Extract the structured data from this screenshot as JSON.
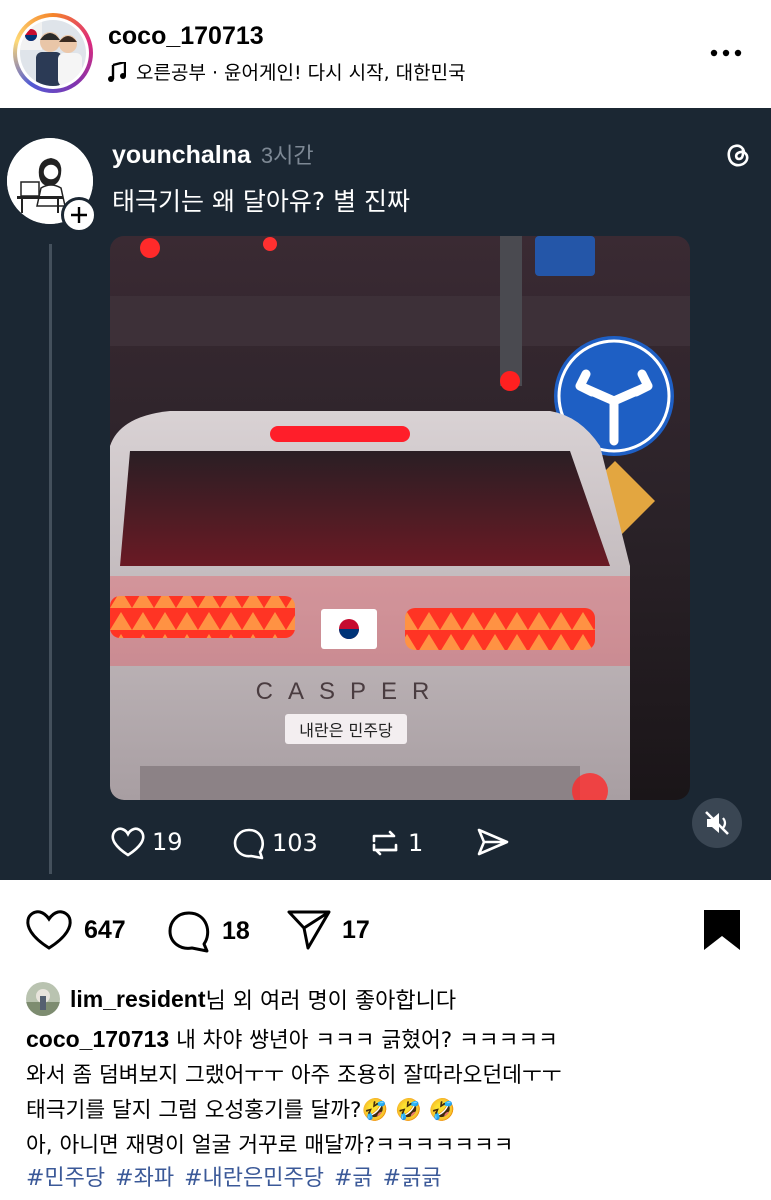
{
  "header": {
    "username": "coco_170713",
    "music": "오른공부 · 윤어게인! 다시 시작, 대한민국"
  },
  "threads_post": {
    "username": "younchalna",
    "time": "3시간",
    "text": "태극기는 왜 달아유?  별 진짜",
    "photo": {
      "brand_text": "CASPER",
      "sticker_text": "내란은 민주당"
    },
    "likes": "19",
    "replies": "103",
    "reposts": "1"
  },
  "post_actions": {
    "likes": "647",
    "comments": "18",
    "shares": "17"
  },
  "liked_by": {
    "name": "lim_resident",
    "suffix": "님 외 여러 명이 좋아합니다"
  },
  "caption": {
    "username": "coco_170713",
    "line1": " 내 차야 썅년아 ㅋㅋㅋ 긁혔어? ㅋㅋㅋㅋㅋ",
    "line2": "와서 좀 덤벼보지 그랬어ㅜㅜ 아주 조용히 잘따라오던데ㅜㅜ",
    "line3": "태극기를 달지 그럼 오성홍기를 달까?🤣 🤣 🤣",
    "line4": "아, 아니면 재명이 얼굴 거꾸로 매달까?ㅋㅋㅋㅋㅋㅋㅋ"
  },
  "hashtags": [
    "#민주당",
    "#좌파",
    "#내란은민주당",
    "#긁",
    "#긁긁"
  ]
}
